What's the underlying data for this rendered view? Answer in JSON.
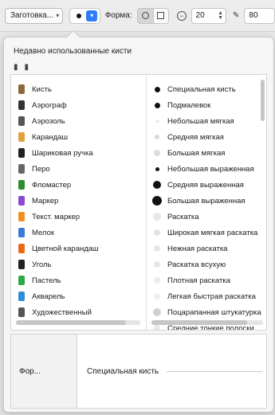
{
  "toolbar": {
    "preset_label": "Заготовка...",
    "shape_label": "Форма:",
    "size_value": "20",
    "opacity_value": "80"
  },
  "popover": {
    "recent_title": "Недавно использованные кисти",
    "left_items": [
      {
        "label": "Кисть",
        "icon": "brush-icon",
        "color": "#8a6a3a"
      },
      {
        "label": "Аэрограф",
        "icon": "airbrush-icon",
        "color": "#333333"
      },
      {
        "label": "Аэрозоль",
        "icon": "spray-can-icon",
        "color": "#555555"
      },
      {
        "label": "Карандаш",
        "icon": "pencil-icon",
        "color": "#e0a040"
      },
      {
        "label": "Шариковая ручка",
        "icon": "ballpoint-pen-icon",
        "color": "#222222"
      },
      {
        "label": "Перо",
        "icon": "quill-icon",
        "color": "#666666"
      },
      {
        "label": "Фломастер",
        "icon": "felt-tip-icon",
        "color": "#2e8b2e"
      },
      {
        "label": "Маркер",
        "icon": "marker-icon",
        "color": "#8a4ad0"
      },
      {
        "label": "Текст. маркер",
        "icon": "highlighter-icon",
        "color": "#f09020"
      },
      {
        "label": "Мелок",
        "icon": "crayon-icon",
        "color": "#3a7ad8"
      },
      {
        "label": "Цветной карандаш",
        "icon": "colored-pencil-icon",
        "color": "#e46a1a"
      },
      {
        "label": "Уголь",
        "icon": "charcoal-icon",
        "color": "#222222"
      },
      {
        "label": "Пастель",
        "icon": "pastel-icon",
        "color": "#2fa84a"
      },
      {
        "label": "Акварель",
        "icon": "watercolor-icon",
        "color": "#2d8fd8"
      },
      {
        "label": "Художественный",
        "icon": "artistic-icon",
        "color": "#555555"
      }
    ],
    "right_items": [
      {
        "label": "Специальная кисть",
        "size": 7,
        "color": "#111111"
      },
      {
        "label": "Подмалевок",
        "size": 7,
        "color": "#111111"
      },
      {
        "label": "Небольшая мягкая",
        "size": 3,
        "color": "#d8d8d8"
      },
      {
        "label": "Средняя мягкая",
        "size": 6,
        "color": "#dadada"
      },
      {
        "label": "Большая мягкая",
        "size": 8,
        "color": "#dcdcdc"
      },
      {
        "label": "Небольшая выраженная",
        "size": 5,
        "color": "#111111"
      },
      {
        "label": "Средняя выраженная",
        "size": 10,
        "color": "#111111"
      },
      {
        "label": "Большая выраженная",
        "size": 12,
        "color": "#111111"
      },
      {
        "label": "Раскатка",
        "size": 10,
        "color": "#e6e6e6"
      },
      {
        "label": "Широкая мягкая раскатка",
        "size": 8,
        "color": "#e2e2e2"
      },
      {
        "label": "Нежная раскатка",
        "size": 8,
        "color": "#e6e6e6"
      },
      {
        "label": "Раскатка всухую",
        "size": 8,
        "color": "#e6e6e6"
      },
      {
        "label": "Плотная раскатка",
        "size": 8,
        "color": "#ececec"
      },
      {
        "label": "Легкая быстрая раскатка",
        "size": 8,
        "color": "#efefef"
      },
      {
        "label": "Поцарапанная штукатурка",
        "size": 10,
        "color": "#d0d0d0"
      },
      {
        "label": "Средние тонкие полоски",
        "size": 8,
        "color": "#e8e8e8"
      }
    ],
    "bottom_left_label": "Фор...",
    "bottom_right_label": "Специальная кисть"
  }
}
